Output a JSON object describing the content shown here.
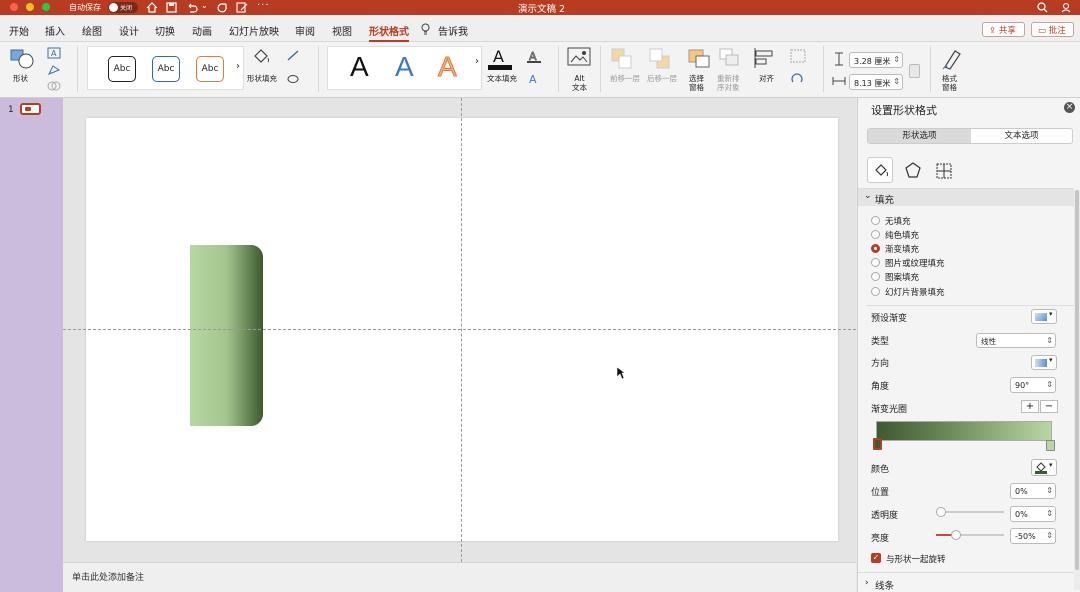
{
  "window": {
    "autosave_label": "自动保存",
    "autosave_state": "关闭",
    "title": "演示文稿 2"
  },
  "tabs": [
    "开始",
    "插入",
    "绘图",
    "设计",
    "切换",
    "动画",
    "幻灯片放映",
    "审阅",
    "视图",
    "形状格式"
  ],
  "active_tab_index": 9,
  "tell_me": "告诉我",
  "share_label": "共享",
  "comments_label": "批注",
  "ribbon": {
    "shape_label": "形状",
    "shape_styles": [
      "Abc",
      "Abc",
      "Abc"
    ],
    "shape_fill_label": "形状填充",
    "wordart": [
      "A",
      "A",
      "A"
    ],
    "text_fill_label": "文本填充",
    "alt_text_label": "Alt\n文本",
    "bring_forward_label": "前移一层",
    "send_backward_label": "后移一层",
    "selection_pane_label": "选择\n窗格",
    "reorder_label": "重新排\n序对象",
    "align_label": "对齐",
    "height_value": "3.28 厘米",
    "width_value": "8.13 厘米",
    "format_pane_label": "格式\n窗格"
  },
  "slide_number": "1",
  "notes_placeholder": "单击此处添加备注",
  "panel": {
    "title": "设置形状格式",
    "tabs": [
      "形状选项",
      "文本选项"
    ],
    "fill_section": "填充",
    "fill_options": [
      "无填充",
      "纯色填充",
      "渐变填充",
      "图片或纹理填充",
      "图案填充",
      "幻灯片背景填充"
    ],
    "selected_fill_index": 2,
    "preset_gradient_label": "预设渐变",
    "type_label": "类型",
    "type_value": "线性",
    "direction_label": "方向",
    "angle_label": "角度",
    "angle_value": "90°",
    "gradient_stops_label": "渐变光圈",
    "color_label": "颜色",
    "position_label": "位置",
    "position_value": "0%",
    "transparency_label": "透明度",
    "transparency_value": "0%",
    "transparency_level": 0,
    "brightness_label": "亮度",
    "brightness_value": "-50%",
    "brightness_level": 0.25,
    "rotate_with_shape_label": "与形状一起旋转",
    "rotate_with_shape_checked": true,
    "line_section": "线条"
  },
  "colors": {
    "accent": "#b83c21",
    "gradient_dark": "#3d5a30",
    "gradient_light": "#b8d7a3"
  }
}
